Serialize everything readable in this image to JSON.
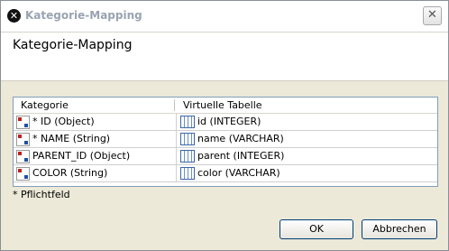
{
  "window": {
    "title": "Kategorie-Mapping",
    "close_glyph": "✕"
  },
  "header": {
    "heading": "Kategorie-Mapping"
  },
  "table": {
    "columns": [
      "Kategorie",
      "Virtuelle Tabelle"
    ],
    "rows": [
      {
        "kategorie": "* ID (Object)",
        "tabelle": "id (INTEGER)"
      },
      {
        "kategorie": "* NAME (String)",
        "tabelle": "name (VARCHAR)"
      },
      {
        "kategorie": "PARENT_ID (Object)",
        "tabelle": "parent (INTEGER)"
      },
      {
        "kategorie": "COLOR (String)",
        "tabelle": "color (VARCHAR)"
      }
    ]
  },
  "footnote": "* Pflichtfeld",
  "buttons": {
    "ok": "OK",
    "cancel": "Abbrechen"
  }
}
